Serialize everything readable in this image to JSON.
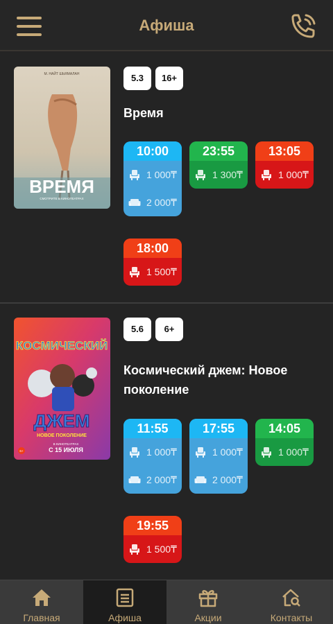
{
  "header": {
    "title": "Афиша",
    "menu_icon": "hamburger-menu-icon",
    "phone_icon": "phone-call-icon"
  },
  "colors": {
    "accent": "#c7aa78",
    "background": "#242424",
    "blue": "#1db7f4",
    "green": "#22b54d",
    "red": "#f03f17"
  },
  "movies": [
    {
      "rating": "5.3",
      "age": "16+",
      "title": "Время",
      "poster": {
        "credit": "М. НАЙТ ШЬЯМАЛАН",
        "title": "ВРЕМЯ",
        "subtitle": "СМОТРИТЕ В КИНОТЕАТРАХ"
      },
      "seances": [
        {
          "time": "10:00",
          "color": "blue",
          "prices": [
            {
              "icon": "seat-icon",
              "value": "1 000₸"
            },
            {
              "icon": "sofa-icon",
              "value": "2 000₸"
            }
          ]
        },
        {
          "time": "23:55",
          "color": "green",
          "prices": [
            {
              "icon": "seat-icon",
              "value": "1 300₸"
            }
          ]
        },
        {
          "time": "13:05",
          "color": "red",
          "prices": [
            {
              "icon": "seat-icon",
              "value": "1 000₸"
            }
          ]
        },
        {
          "time": "18:00",
          "color": "red",
          "prices": [
            {
              "icon": "seat-icon",
              "value": "1 500₸"
            }
          ]
        }
      ]
    },
    {
      "rating": "5.6",
      "age": "6+",
      "title": "Космический джем: Новое поколение",
      "poster": {
        "title_top": "КОСМИЧЕСКИЙ",
        "title_bottom": "ДЖЕМ",
        "subtitle": "НОВОЕ ПОКОЛЕНИЕ",
        "date_line1": "В КИНОТЕАТРАХ",
        "date_line2": "С 15 ИЮЛЯ",
        "age": "6+"
      },
      "seances": [
        {
          "time": "11:55",
          "color": "blue",
          "prices": [
            {
              "icon": "seat-icon",
              "value": "1 000₸"
            },
            {
              "icon": "sofa-icon",
              "value": "2 000₸"
            }
          ]
        },
        {
          "time": "17:55",
          "color": "blue",
          "prices": [
            {
              "icon": "seat-icon",
              "value": "1 000₸"
            },
            {
              "icon": "sofa-icon",
              "value": "2 000₸"
            }
          ]
        },
        {
          "time": "14:05",
          "color": "green",
          "prices": [
            {
              "icon": "seat-icon",
              "value": "1 000₸"
            }
          ]
        },
        {
          "time": "19:55",
          "color": "red",
          "prices": [
            {
              "icon": "seat-icon",
              "value": "1 500₸"
            }
          ]
        }
      ]
    }
  ],
  "nav": [
    {
      "label": "Главная",
      "icon": "home-icon",
      "active": false
    },
    {
      "label": "Афиша",
      "icon": "poster-list-icon",
      "active": true
    },
    {
      "label": "Акции",
      "icon": "gift-icon",
      "active": false
    },
    {
      "label": "Контакты",
      "icon": "contacts-search-icon",
      "active": false
    }
  ]
}
